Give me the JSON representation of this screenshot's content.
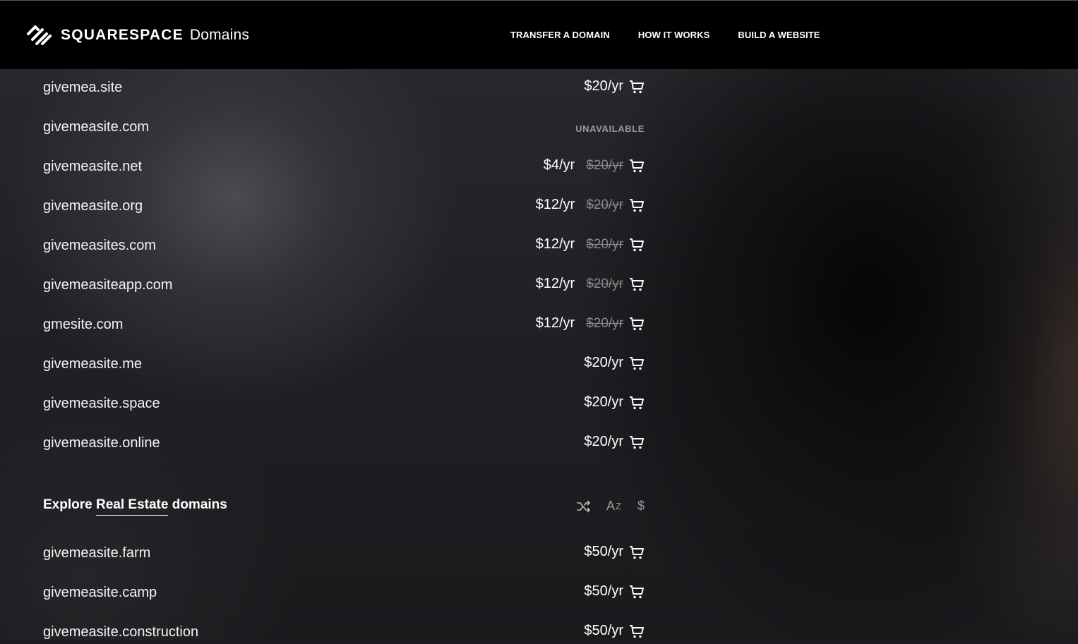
{
  "header": {
    "brand": "SQUARESPACE",
    "brand_sub": "Domains",
    "nav": [
      "TRANSFER A DOMAIN",
      "HOW IT WORKS",
      "BUILD A WEBSITE"
    ]
  },
  "results": [
    {
      "domain": "givemea.site",
      "price": "$20/yr",
      "old_price": "",
      "available": true
    },
    {
      "domain": "givemeasite.com",
      "price": "",
      "old_price": "",
      "available": false,
      "status": "UNAVAILABLE"
    },
    {
      "domain": "givemeasite.net",
      "price": "$4/yr",
      "old_price": "$20/yr",
      "available": true
    },
    {
      "domain": "givemeasite.org",
      "price": "$12/yr",
      "old_price": "$20/yr",
      "available": true
    },
    {
      "domain": "givemeasites.com",
      "price": "$12/yr",
      "old_price": "$20/yr",
      "available": true
    },
    {
      "domain": "givemeasiteapp.com",
      "price": "$12/yr",
      "old_price": "$20/yr",
      "available": true
    },
    {
      "domain": "gmesite.com",
      "price": "$12/yr",
      "old_price": "$20/yr",
      "available": true
    },
    {
      "domain": "givemeasite.me",
      "price": "$20/yr",
      "old_price": "",
      "available": true
    },
    {
      "domain": "givemeasite.space",
      "price": "$20/yr",
      "old_price": "",
      "available": true
    },
    {
      "domain": "givemeasite.online",
      "price": "$20/yr",
      "old_price": "",
      "available": true
    }
  ],
  "section": {
    "title_prefix": "Explore ",
    "title_highlight": "Real Estate",
    "title_suffix": " domains",
    "sort_icons": [
      "shuffle-icon",
      "sort-alpha-icon",
      "sort-price-icon"
    ],
    "sort_alpha_a": "A",
    "sort_alpha_z": "Z",
    "sort_price": "$"
  },
  "section_results": [
    {
      "domain": "givemeasite.farm",
      "price": "$50/yr"
    },
    {
      "domain": "givemeasite.camp",
      "price": "$50/yr"
    },
    {
      "domain": "givemeasite.construction",
      "price": "$50/yr"
    }
  ],
  "colors": {
    "header_bg": "#000000",
    "text": "#ffffff",
    "muted": "#8a8a8a"
  }
}
